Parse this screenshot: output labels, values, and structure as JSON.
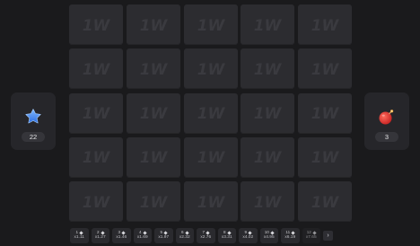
{
  "board": {
    "tile_logo_text": "1W",
    "rows": 5,
    "columns": 5
  },
  "gems_panel": {
    "icon": "star-gem-icon",
    "count": "22",
    "accent_color": "#3d8bfd"
  },
  "bombs_panel": {
    "icon": "bomb-icon",
    "count": "3",
    "accent_color": "#e53935"
  },
  "multipliers": [
    {
      "gems": "1",
      "value": "x1.11"
    },
    {
      "gems": "2",
      "value": "x1.27"
    },
    {
      "gems": "3",
      "value": "x1.46"
    },
    {
      "gems": "4",
      "value": "x1.69"
    },
    {
      "gems": "5",
      "value": "x1.97"
    },
    {
      "gems": "6",
      "value": "x2.32"
    },
    {
      "gems": "7",
      "value": "x2.76"
    },
    {
      "gems": "8",
      "value": "x3.31"
    },
    {
      "gems": "9",
      "value": "x4.02"
    },
    {
      "gems": "10",
      "value": "x4.95"
    },
    {
      "gems": "11",
      "value": "x6.19"
    },
    {
      "gems": "12",
      "value": "x7.65"
    }
  ],
  "next_button_label": "›"
}
